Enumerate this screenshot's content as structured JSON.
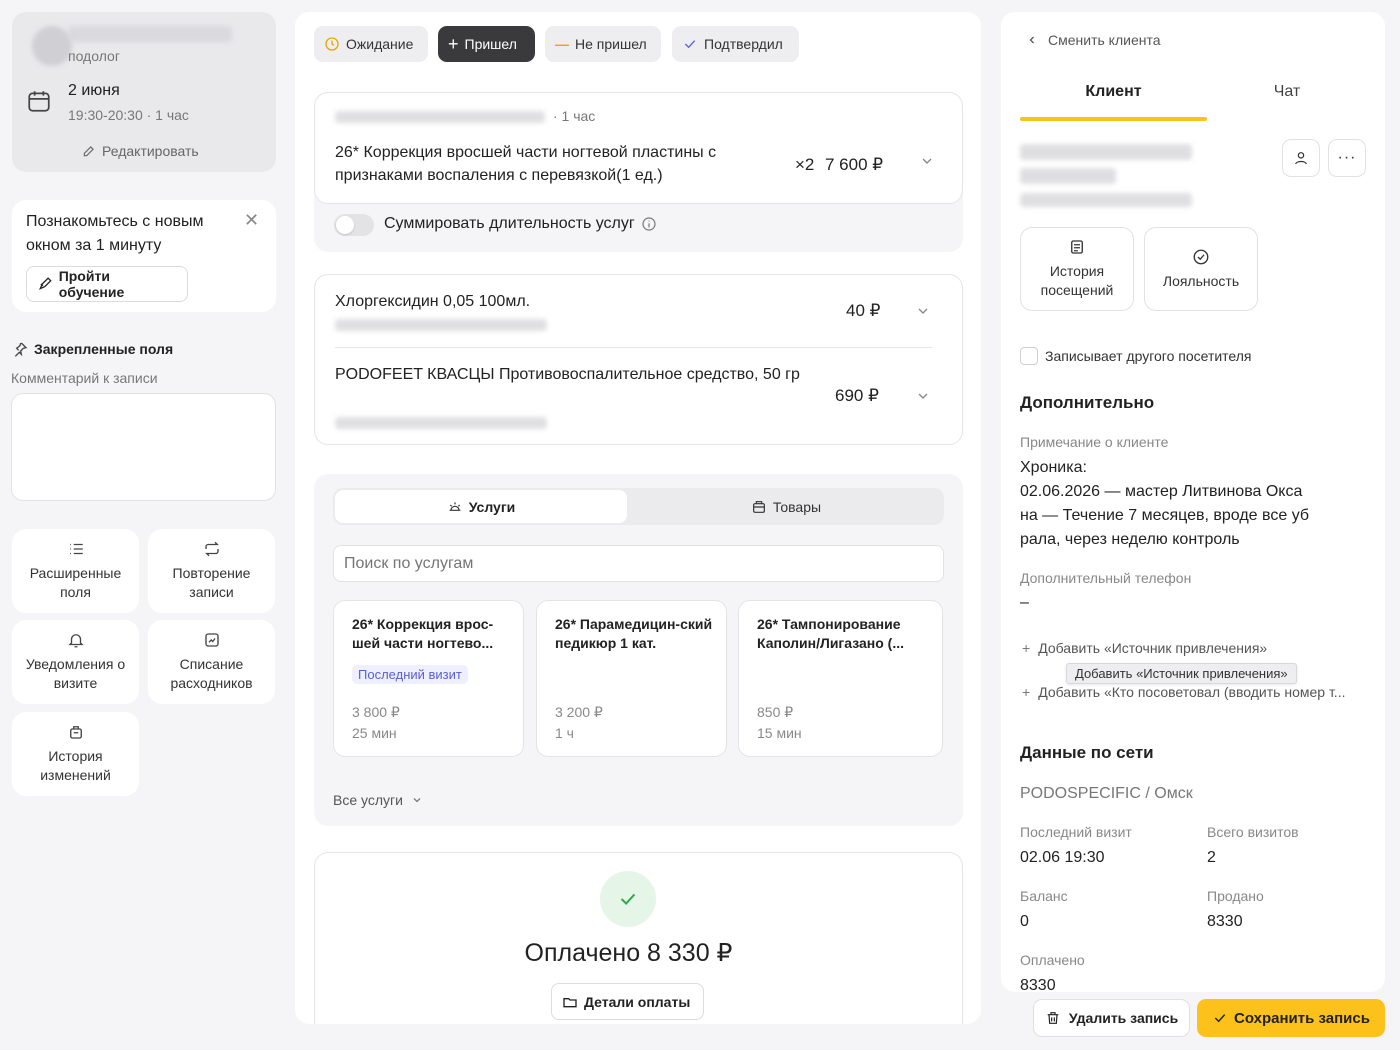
{
  "appointment": {
    "specialist_role": "подолог",
    "date": "2 июня",
    "time": "19:30-20:30 · 1 час",
    "edit_label": "Редактировать"
  },
  "onboarding": {
    "text": "Познакомьтесь с новым окном за 1 минуту",
    "button": "Пройти обучение"
  },
  "pinned": {
    "title": "Закрепленные поля",
    "comment_label": "Комментарий к записи",
    "comment_value": ""
  },
  "tiles": [
    {
      "label": "Расширенные поля",
      "icon": "list-icon"
    },
    {
      "label": "Повторение записи",
      "icon": "repeat-icon"
    },
    {
      "label": "Уведомления о визите",
      "icon": "bell-icon"
    },
    {
      "label": "Списание расходников",
      "icon": "writeoff-icon"
    },
    {
      "label": "История изменений",
      "icon": "history-icon"
    }
  ],
  "status": {
    "waiting": "Ожидание",
    "came": "Пришел",
    "not_came": "Не пришел",
    "confirmed": "Подтвердил",
    "active": "came"
  },
  "main_service": {
    "duration": "· 1 час",
    "name": "26* Коррекция вросшей части ногтевой пластины с признаками воспаления с перевязкой(1 ед.)",
    "qty": "×2",
    "price": "7 600 ₽",
    "sum_duration_label": "Суммировать длительность услуг",
    "sum_duration_on": false
  },
  "goods": [
    {
      "name": "Хлоргексидин 0,05 100мл.",
      "price": "40 ₽"
    },
    {
      "name": "PODOFEET КВАСЦЫ Противовоспалительное средство, 50 гр",
      "price": "690 ₽"
    }
  ],
  "catalog": {
    "tab_services": "Услуги",
    "tab_goods": "Товары",
    "active_tab": "services",
    "search_placeholder": "Поиск по услугам",
    "cards": [
      {
        "name": "26* Коррекция врос-шей части ногтево...",
        "badge": "Последний визит",
        "price": "3 800 ₽",
        "duration": "25 мин"
      },
      {
        "name": "26* Парамедицин-ский педикюр 1 кат.",
        "badge": "",
        "price": "3 200 ₽",
        "duration": "1 ч"
      },
      {
        "name": "26* Тампонирование Каполин/Лигазано (...",
        "badge": "",
        "price": "850 ₽",
        "duration": "15 мин"
      }
    ],
    "all_services": "Все услуги"
  },
  "payment": {
    "title": "Оплачено 8 330 ₽",
    "details_button": "Детали оплаты"
  },
  "client_panel": {
    "back_label": "Сменить клиента",
    "tab_client": "Клиент",
    "tab_chat": "Чат",
    "active_tab": "client",
    "tile_history": "История посещений",
    "tile_loyalty": "Лояльность",
    "other_visitor_label": "Записывает другого посетителя",
    "other_visitor_checked": false,
    "additional_title": "Дополнительно",
    "note_label": "Примечание о клиенте",
    "note_lines": [
      "Хроника:",
      "02.06.2026 — мастер Литвинова Окса",
      "на — Течение 7 месяцев, вроде все уб",
      "рала, через неделю контроль"
    ],
    "extra_phone_label": "Дополнительный телефон",
    "extra_phone_value": "–",
    "add_source": "Добавить «Источник привлечения»",
    "add_source_tooltip": "Добавить «Источник привлечения»",
    "add_referrer": "Добавить «Кто посоветовал (вводить номер т...",
    "network_title": "Данные по сети",
    "network_name": "PODOSPECIFIC / Омск",
    "last_visit_label": "Последний визит",
    "last_visit_value": "02.06 19:30",
    "total_visits_label": "Всего визитов",
    "total_visits_value": "2",
    "balance_label": "Баланс",
    "balance_value": "0",
    "sold_label": "Продано",
    "sold_value": "8330",
    "paid_label": "Оплачено",
    "paid_value": "8330"
  },
  "actions": {
    "delete": "Удалить запись",
    "save": "Сохранить запись"
  },
  "colors": {
    "accent": "#fcc21b",
    "active_status": "#3a3a3d",
    "success": "#2eaa4a",
    "badge": "#5a5fd0"
  }
}
